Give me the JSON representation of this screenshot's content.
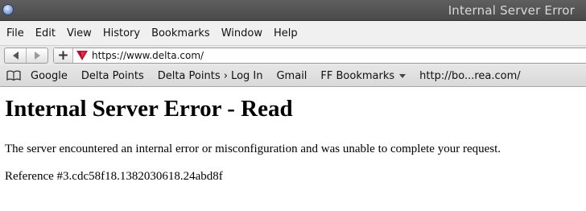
{
  "window": {
    "title": "Internal Server Error"
  },
  "menubar": {
    "items": [
      "File",
      "Edit",
      "View",
      "History",
      "Bookmarks",
      "Window",
      "Help"
    ]
  },
  "toolbar": {
    "back_icon": "back-arrow-icon",
    "forward_icon": "forward-arrow-icon",
    "new_tab_label": "+",
    "site_icon": "delta-logo-icon",
    "url": "https://www.delta.com/"
  },
  "bookmarks_bar": {
    "icon": "open-book-icon",
    "items": [
      "Google",
      "Delta Points",
      "Delta Points › Log In",
      "Gmail",
      "FF Bookmarks",
      "http://bo...rea.com/"
    ]
  },
  "page": {
    "heading": "Internal Server Error - Read",
    "message": "The server encountered an internal error or misconfiguration and was unable to complete your request.",
    "reference": "Reference #3.cdc58f18.1382030618.24abd8f"
  },
  "colors": {
    "titlebar": "#4a4a4a",
    "title_text": "#d8d8d8",
    "delta_red": "#c8102e"
  }
}
